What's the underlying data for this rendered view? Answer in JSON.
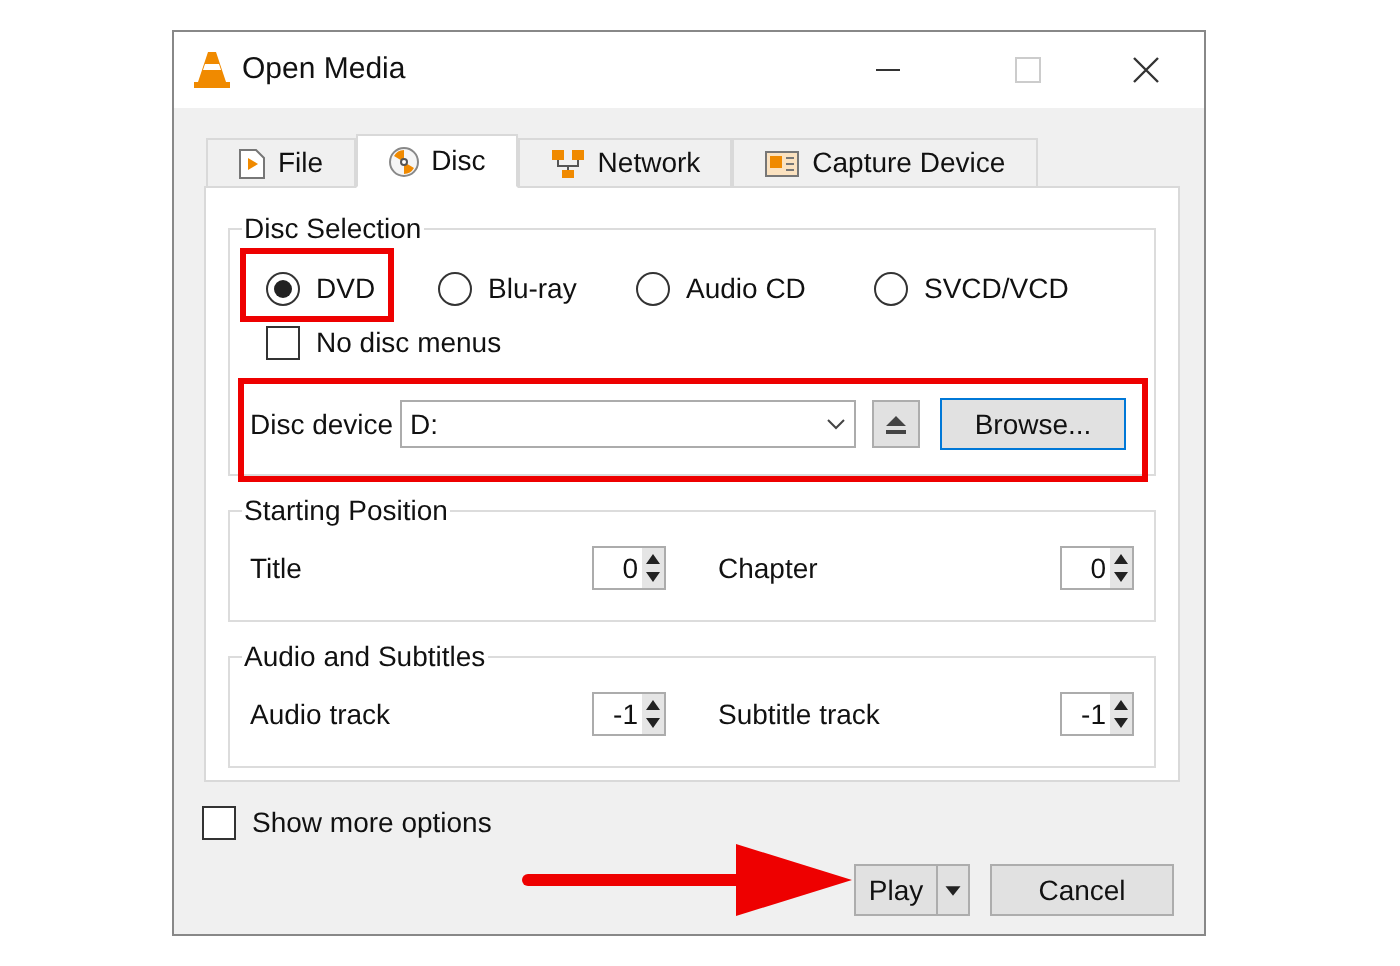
{
  "window": {
    "title": "Open Media"
  },
  "tabs": [
    {
      "label": "File",
      "selected": false
    },
    {
      "label": "Disc",
      "selected": true
    },
    {
      "label": "Network",
      "selected": false
    },
    {
      "label": "Capture Device",
      "selected": false
    }
  ],
  "disc_selection": {
    "title": "Disc Selection",
    "options": [
      {
        "label": "DVD",
        "selected": true
      },
      {
        "label": "Blu-ray",
        "selected": false
      },
      {
        "label": "Audio CD",
        "selected": false
      },
      {
        "label": "SVCD/VCD",
        "selected": false
      }
    ],
    "no_disc_menus": {
      "label": "No disc menus",
      "checked": false
    },
    "disc_device": {
      "label": "Disc device",
      "value": "D:"
    },
    "browse_button": "Browse..."
  },
  "starting_position": {
    "title": "Starting Position",
    "fields": [
      {
        "label": "Title",
        "value": "0"
      },
      {
        "label": "Chapter",
        "value": "0"
      }
    ]
  },
  "audio_and_subtitles": {
    "title": "Audio and Subtitles",
    "fields": [
      {
        "label": "Audio track",
        "value": "-1"
      },
      {
        "label": "Subtitle track",
        "value": "-1"
      }
    ]
  },
  "show_more_options": {
    "label": "Show more options",
    "checked": false
  },
  "buttons": {
    "play": "Play",
    "cancel": "Cancel"
  }
}
